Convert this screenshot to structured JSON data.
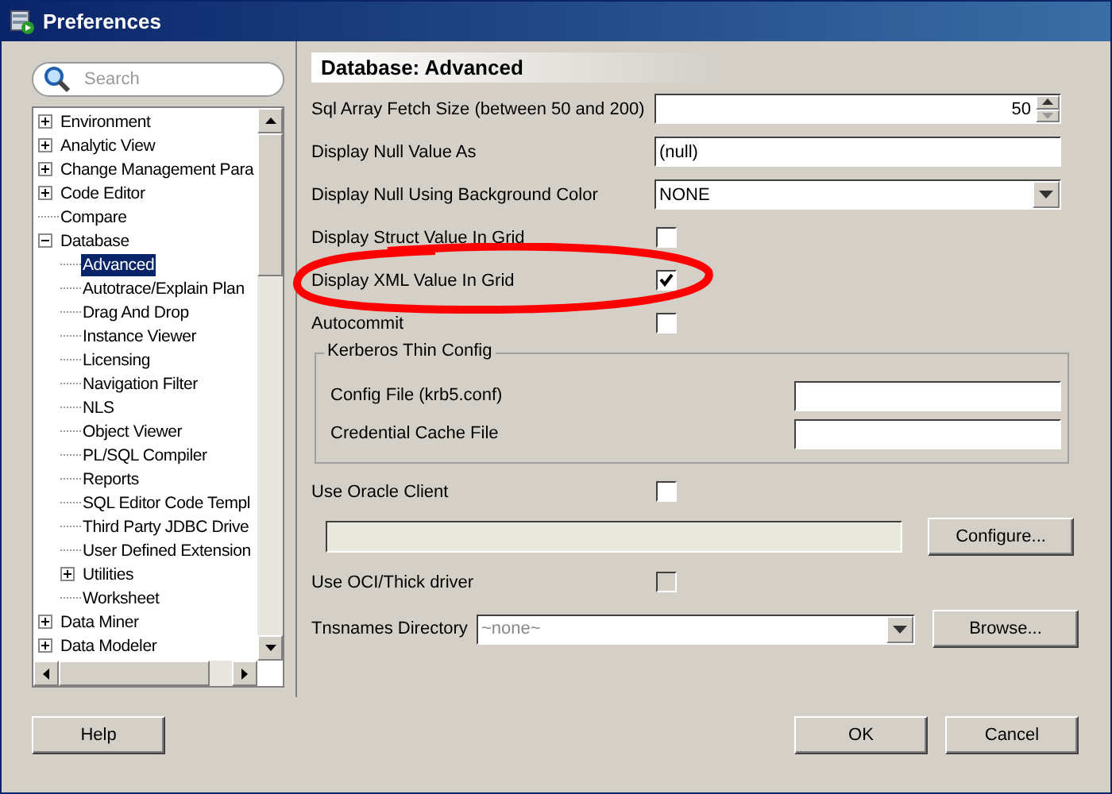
{
  "window": {
    "title": "Preferences"
  },
  "search": {
    "placeholder": "Search"
  },
  "tree": [
    {
      "label": "Environment",
      "kind": "folder",
      "expanded": false,
      "selected": false
    },
    {
      "label": "Analytic View",
      "kind": "folder",
      "expanded": false,
      "selected": false
    },
    {
      "label": "Change Management Para",
      "kind": "folder",
      "expanded": false,
      "selected": false
    },
    {
      "label": "Code Editor",
      "kind": "folder",
      "expanded": false,
      "selected": false
    },
    {
      "label": "Compare",
      "kind": "leaf",
      "selected": false
    },
    {
      "label": "Database",
      "kind": "folder",
      "expanded": true,
      "selected": false,
      "children": [
        {
          "label": "Advanced",
          "kind": "leaf",
          "selected": true
        },
        {
          "label": "Autotrace/Explain Plan",
          "kind": "leaf",
          "selected": false
        },
        {
          "label": "Drag And Drop",
          "kind": "leaf",
          "selected": false
        },
        {
          "label": "Instance Viewer",
          "kind": "leaf",
          "selected": false
        },
        {
          "label": "Licensing",
          "kind": "leaf",
          "selected": false
        },
        {
          "label": "Navigation Filter",
          "kind": "leaf",
          "selected": false
        },
        {
          "label": "NLS",
          "kind": "leaf",
          "selected": false
        },
        {
          "label": "Object Viewer",
          "kind": "leaf",
          "selected": false
        },
        {
          "label": "PL/SQL Compiler",
          "kind": "leaf",
          "selected": false
        },
        {
          "label": "Reports",
          "kind": "leaf",
          "selected": false
        },
        {
          "label": "SQL Editor Code Templ",
          "kind": "leaf",
          "selected": false
        },
        {
          "label": "Third Party JDBC Drive",
          "kind": "leaf",
          "selected": false
        },
        {
          "label": "User Defined Extension",
          "kind": "leaf",
          "selected": false
        },
        {
          "label": "Utilities",
          "kind": "folder",
          "expanded": false,
          "selected": false
        },
        {
          "label": "Worksheet",
          "kind": "leaf",
          "selected": false
        }
      ]
    },
    {
      "label": "Data Miner",
      "kind": "folder",
      "expanded": false,
      "selected": false
    },
    {
      "label": "Data Modeler",
      "kind": "folder",
      "expanded": false,
      "selected": false
    }
  ],
  "page_title": "Database: Advanced",
  "settings": [
    {
      "kind": "spinner",
      "label": "Sql Array Fetch Size (between 50 and 200)",
      "value": "50",
      "circled": false
    },
    {
      "kind": "text",
      "label": "Display Null Value As",
      "value": "(null)",
      "circled": false
    },
    {
      "kind": "combo",
      "label": "Display Null Using Background Color",
      "value": "NONE",
      "circled": false
    },
    {
      "kind": "checkbox",
      "label": "Display Struct Value In Grid",
      "checked": false,
      "disabled": false,
      "circled": false
    },
    {
      "kind": "checkbox",
      "label": "Display XML Value In Grid",
      "checked": true,
      "disabled": false,
      "circled": true
    },
    {
      "kind": "checkbox",
      "label": "Autocommit",
      "checked": false,
      "disabled": false,
      "circled": false
    },
    {
      "kind": "group",
      "label": "Kerberos Thin Config",
      "fields": [
        {
          "label": "Config File (krb5.conf)"
        },
        {
          "label": "Credential Cache File"
        }
      ],
      "circled": false
    },
    {
      "kind": "checkbox",
      "label": "Use Oracle Client",
      "checked": false,
      "disabled": false,
      "circled": false
    },
    {
      "kind": "path",
      "button": "Configure...",
      "circled": false
    },
    {
      "kind": "checkbox",
      "label": "Use OCI/Thick driver",
      "checked": false,
      "disabled": true,
      "circled": false
    },
    {
      "kind": "browse",
      "label": "Tnsnames Directory",
      "placeholder": "~none~",
      "button": "Browse...",
      "circled": false
    }
  ],
  "buttons": {
    "help": "Help",
    "ok": "OK",
    "cancel": "Cancel"
  }
}
